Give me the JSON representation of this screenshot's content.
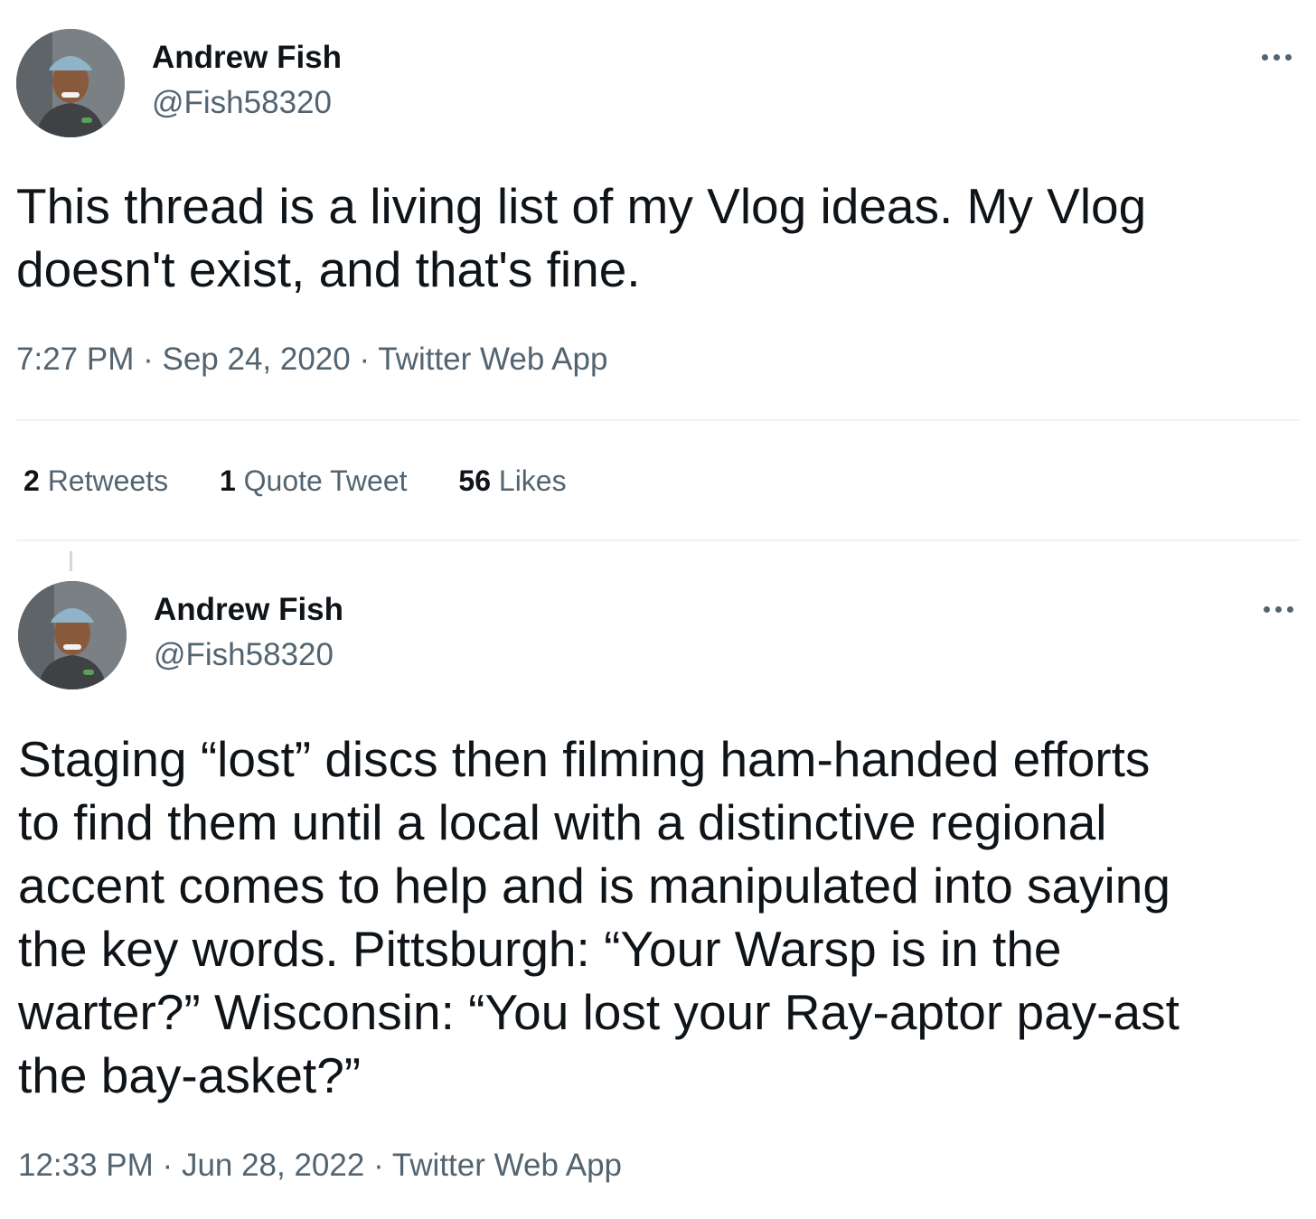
{
  "tweets": [
    {
      "author_name": "Andrew Fish",
      "author_handle": "@Fish58320",
      "text": "This thread is a living list of my Vlog ideas. My Vlog\ndoesn't exist, and that's fine.",
      "meta": {
        "time": "7:27 PM",
        "date": "Sep 24, 2020",
        "source": "Twitter Web App",
        "separator": "·"
      },
      "stats": [
        {
          "count": "2",
          "label": "Retweets"
        },
        {
          "count": "1",
          "label": "Quote Tweet"
        },
        {
          "count": "56",
          "label": "Likes"
        }
      ]
    },
    {
      "author_name": "Andrew Fish",
      "author_handle": "@Fish58320",
      "text": "Staging “lost” discs then filming ham-handed efforts\nto find them until a local with a distinctive regional\naccent comes to help and is manipulated into saying\nthe key words. Pittsburgh: “Your Warsp is in the\nwarter?” Wisconsin: “You lost your Ray-aptor pay-ast\nthe bay-asket?”",
      "meta": {
        "time": "12:33 PM",
        "date": "Jun 28, 2022",
        "source": "Twitter Web App",
        "separator": "·"
      }
    }
  ],
  "icons": {
    "more": "more-horizontal-icon",
    "avatar": "profile-photo"
  },
  "colors": {
    "text_primary": "#0f1419",
    "text_secondary": "#536471",
    "divider": "#eff3f4"
  }
}
